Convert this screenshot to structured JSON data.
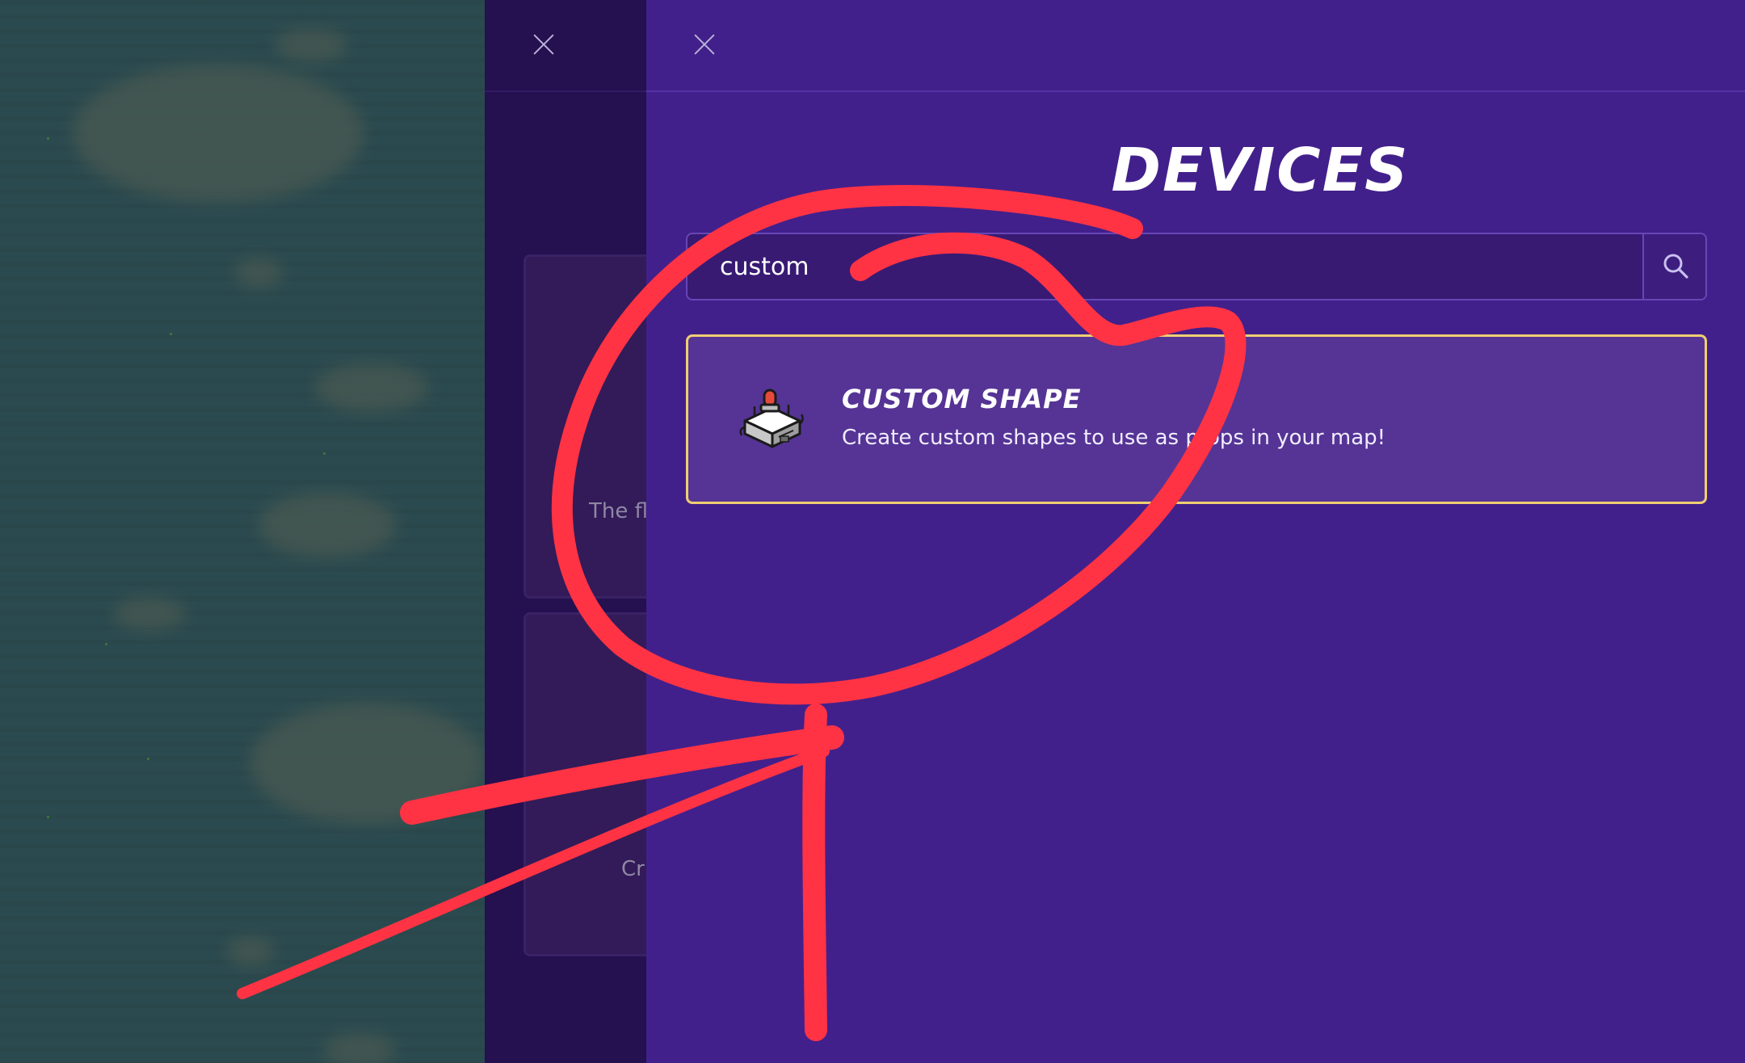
{
  "underlying_panel": {
    "card_texts": [
      "The fl",
      "Cr"
    ]
  },
  "drawer": {
    "title": "DEVICES",
    "search": {
      "value": "custom",
      "placeholder": ""
    }
  },
  "results": [
    {
      "name": "CUSTOM SHAPE",
      "description": "Create custom shapes to use as props in your map!",
      "icon": "custom-shape-device-icon"
    }
  ],
  "colors": {
    "drawer_bg": "#42208b",
    "card_bg": "#553495",
    "card_border": "#f0cf72",
    "annotation": "#ff3344"
  }
}
